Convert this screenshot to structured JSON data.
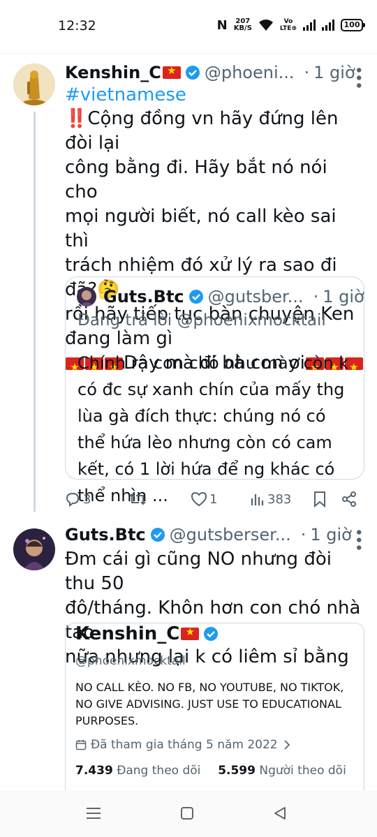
{
  "status_bar": {
    "time": "12:32",
    "nfc": "N",
    "speed_value": "207",
    "speed_unit": "KB/S",
    "volte_top": "Vo",
    "volte_bottom": "LTE⊕",
    "battery": "100"
  },
  "tweets": [
    {
      "name": "Kenshin_C",
      "handle": "@phoeni...",
      "time": "1 giờ",
      "hashtag": "#vietnamese",
      "text_lines": [
        "‼️Cộng đồng vn hãy đứng lên đòi lại",
        "công bằng đi. Hãy bắt nó nói cho",
        "mọi người biết, nó call kèo sai thì",
        "trách nhiệm đó xử lý ra sao đi đã?🤔",
        "rồi hãy tiếp tục bàn chuyện Ken",
        "đang làm gì"
      ],
      "closing": "Dậy mà đi bà con ơi",
      "quote": {
        "name": "Guts.Btc",
        "handle": "@gutsber...",
        "time": "1 giờ",
        "replying": "Đang trả lời @phoenixmocktail",
        "text": "Chính ra con chó như mày còn k có đc sự xanh chín của mấy thg lùa gà đích thực: chúng nó có thể hứa lèo nhưng còn có cam kết, có 1 lời hứa để ng khác có thể nhìn ..."
      },
      "actions": {
        "replies": "3",
        "retweets": "",
        "likes": "1",
        "views": "383"
      }
    },
    {
      "name": "Guts.Btc",
      "handle": "@gutsberser...",
      "time": "1 giờ",
      "text_lines": [
        "Đm cái gì cũng NO nhưng đòi thu 50",
        "đô/tháng. Khôn hơn con chó nhà tao",
        "nữa nhưng lại k có liêm sỉ bằng"
      ],
      "card": {
        "name": "Kenshin_C",
        "handle": "@phoenixmocktail",
        "bio": "NO CALL KÈO. NO FB, NO YOUTUBE, NO TIKTOK, NO GIVE ADVISING. JUST USE TO EDUCATIONAL PURPOSES.",
        "joined": "Đã tham gia tháng 5 năm 2022",
        "following_count": "7.439",
        "following_label": "Đang theo dõi",
        "followers_count": "5.599",
        "followers_label": "Người theo dõi"
      }
    }
  ],
  "colors": {
    "accent": "#1d9bf0",
    "muted": "#536471",
    "border": "#cfd9de",
    "flag_red": "#da251d",
    "flag_star": "#ffde00"
  },
  "icons": [
    "nfc-icon",
    "wifi-icon",
    "signal-icon",
    "battery-icon",
    "verified-icon",
    "more-icon",
    "reply-icon",
    "retweet-icon",
    "like-icon",
    "views-icon",
    "bookmark-icon",
    "share-icon",
    "calendar-icon",
    "chevron-right-icon",
    "menu-icon",
    "home-icon",
    "back-icon"
  ]
}
